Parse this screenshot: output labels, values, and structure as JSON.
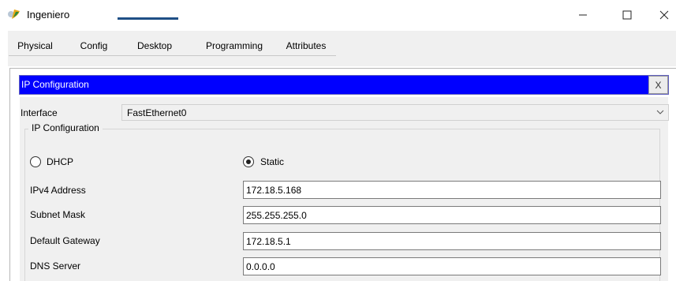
{
  "window": {
    "title": "Ingeniero",
    "icon": "app-leaf-icon",
    "controls": {
      "minimize_icon": "minimize-icon",
      "maximize_icon": "maximize-icon",
      "close_icon": "close-icon"
    }
  },
  "tabs": [
    {
      "label": "Physical",
      "active": false
    },
    {
      "label": "Config",
      "active": false
    },
    {
      "label": "Desktop",
      "active": true
    },
    {
      "label": "Programming",
      "active": false
    },
    {
      "label": "Attributes",
      "active": false
    }
  ],
  "ip_config": {
    "title": "IP Configuration",
    "close_label": "X",
    "interface_label": "Interface",
    "interface_value": "FastEthernet0",
    "group_label": "IP Configuration",
    "mode": {
      "dhcp_label": "DHCP",
      "static_label": "Static",
      "selected": "Static"
    },
    "fields": {
      "ipv4_label": "IPv4 Address",
      "ipv4_value": "172.18.5.168",
      "subnet_label": "Subnet Mask",
      "subnet_value": "255.255.255.0",
      "gateway_label": "Default Gateway",
      "gateway_value": "172.18.5.1",
      "dns_label": "DNS Server",
      "dns_value": "0.0.0.0"
    }
  },
  "colors": {
    "title_bar_blue": "#0000ff",
    "tab_underline": "#1f4f86",
    "panel_bg": "#f0f0f0"
  }
}
